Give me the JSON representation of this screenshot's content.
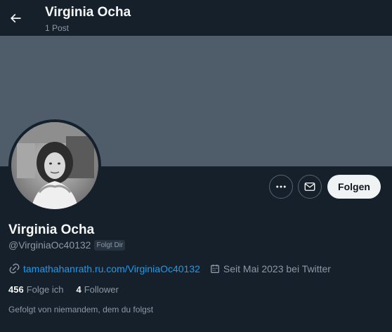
{
  "header": {
    "name": "Virginia Ocha",
    "posts": "1 Post"
  },
  "actions": {
    "follow_label": "Folgen"
  },
  "profile": {
    "name": "Virginia Ocha",
    "handle": "@VirginiaOc40132",
    "follows_you_badge": "Folgt Dir",
    "link": "tamathahanrath.ru.com/VirginiaOc40132",
    "joined": "Seit Mai 2023 bei Twitter"
  },
  "stats": {
    "following_count": "456",
    "following_label": "Folge ich",
    "followers_count": "4",
    "followers_label": "Follower"
  },
  "followed_by": "Gefolgt von niemandem, dem du folgst",
  "colors": {
    "background": "#15202b",
    "banner": "#4f5d6a",
    "link": "#1d9bf0",
    "muted": "#8b98a5",
    "follow_button": "#eff3f4"
  }
}
